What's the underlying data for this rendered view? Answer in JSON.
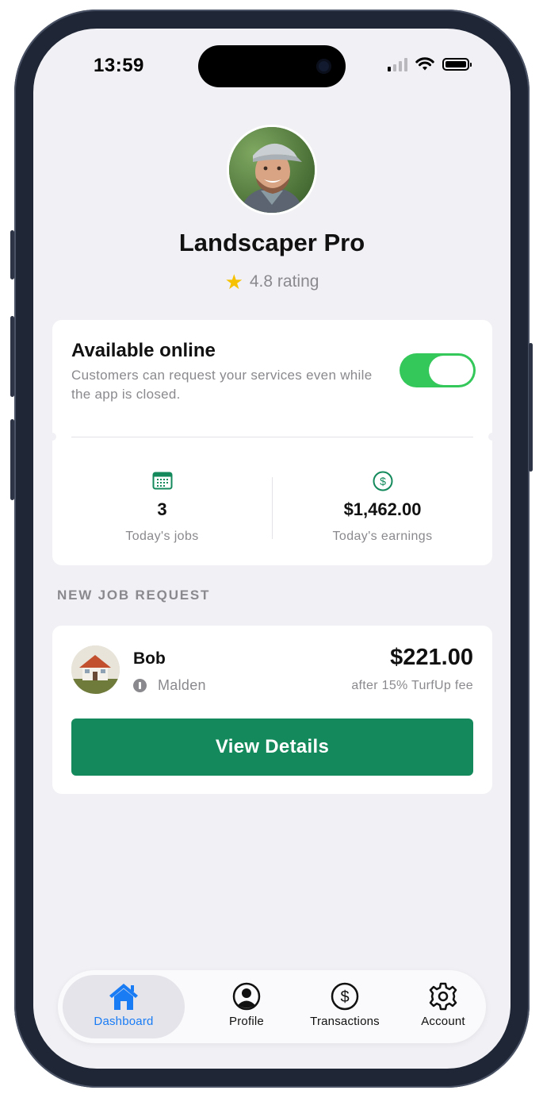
{
  "status_bar": {
    "time": "13:59"
  },
  "profile": {
    "name": "Landscaper Pro",
    "rating": "4.8 rating"
  },
  "availability": {
    "title": "Available online",
    "description": "Customers can request your services even while the app is closed.",
    "enabled": true
  },
  "stats": [
    {
      "value": "3",
      "label": "Today's jobs",
      "icon": "calendar-icon"
    },
    {
      "value": "$1,462.00",
      "label": "Today's earnings",
      "icon": "dollar-circle-icon"
    }
  ],
  "job_section": {
    "heading": "NEW JOB REQUEST"
  },
  "job": {
    "customer": "Bob",
    "location": "Malden",
    "price": "$221.00",
    "fee_note": "after 15% TurfUp fee",
    "button_label": "View Details"
  },
  "tabs": [
    {
      "label": "Dashboard",
      "icon": "house-icon",
      "active": true
    },
    {
      "label": "Profile",
      "icon": "person-circle-icon",
      "active": false
    },
    {
      "label": "Transactions",
      "icon": "dollar-circle-icon",
      "active": false
    },
    {
      "label": "Account",
      "icon": "gear-icon",
      "active": false
    }
  ],
  "colors": {
    "accent_green": "#148a5c",
    "toggle_green": "#34c759",
    "active_tab_blue": "#1a7cf5"
  }
}
